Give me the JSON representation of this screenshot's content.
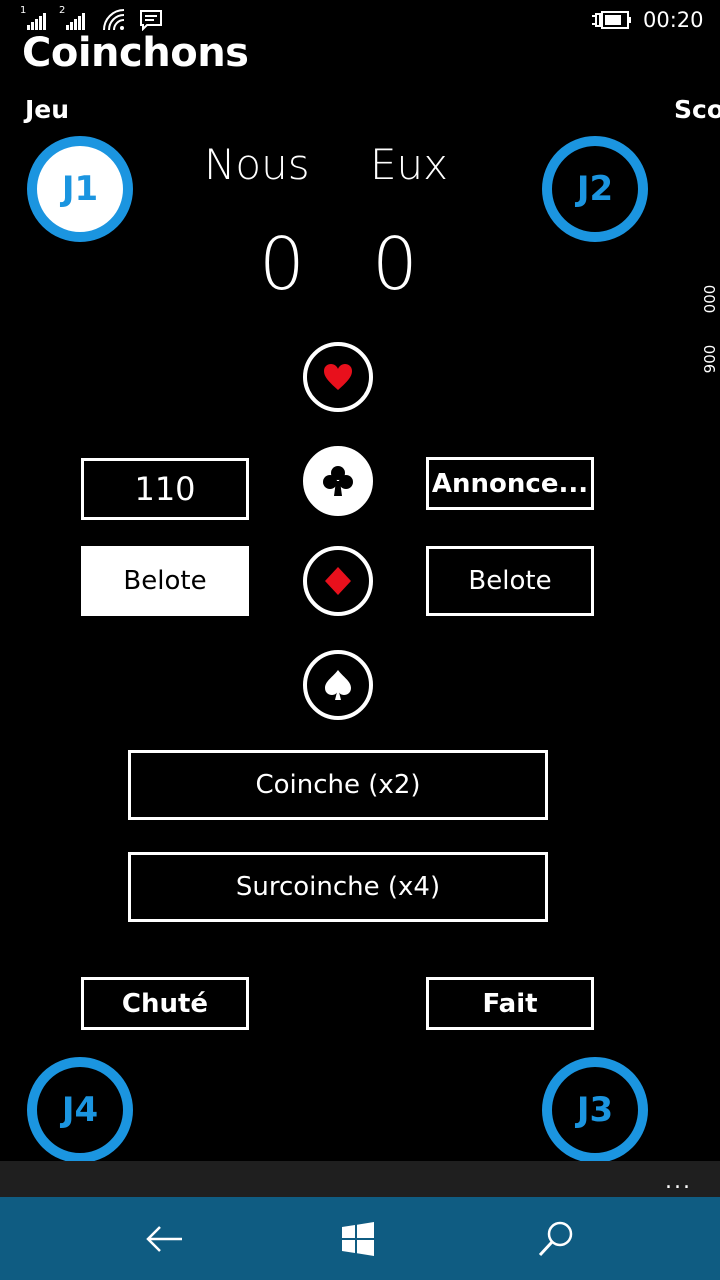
{
  "status_bar": {
    "sim1": "1",
    "sim2": "2",
    "time": "00:20"
  },
  "app": {
    "title": "Coinchons",
    "pivot_current": "Jeu",
    "pivot_next": "Sco"
  },
  "score": {
    "team_us_label": "Nous",
    "team_them_label": "Eux",
    "team_us_score": "0",
    "team_them_score": "0",
    "side_values": [
      "000",
      "900"
    ]
  },
  "players": {
    "p1": "J1",
    "p2": "J2",
    "p3": "J3",
    "p4": "J4"
  },
  "bid": {
    "value": "110",
    "announce_label": "Annonce...",
    "belote_left": "Belote",
    "belote_right": "Belote",
    "coinche_label": "Coinche (x2)",
    "surcoinche_label": "Surcoinche (x4)",
    "chute_label": "Chuté",
    "fait_label": "Fait",
    "selected_suit": "clubs"
  },
  "suits": [
    "hearts-icon",
    "clubs-icon",
    "diamonds-icon",
    "spades-icon"
  ],
  "appbar": {
    "more_label": "..."
  },
  "colors": {
    "accent": "#1b95e0",
    "suit_red": "#e8101c",
    "navbar": "#0f5c82",
    "background": "#000000"
  }
}
